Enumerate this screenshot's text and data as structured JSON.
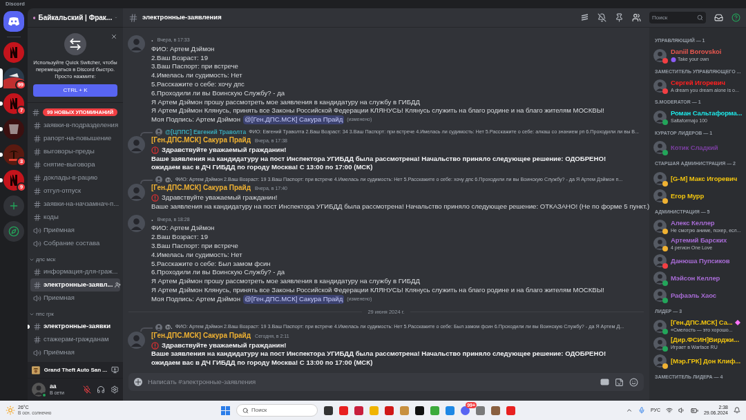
{
  "app": {
    "title": "Discord"
  },
  "servers": [
    {
      "kind": "home",
      "selected": false,
      "unread": false
    },
    {
      "kind": "red",
      "selected": false,
      "unread": false
    },
    {
      "kind": "photo",
      "selected": true,
      "unread": false,
      "badge": "99"
    },
    {
      "kind": "red",
      "selected": false,
      "unread": true,
      "badge": "7"
    },
    {
      "kind": "dark",
      "selected": false,
      "unread": true
    },
    {
      "kind": "palm",
      "selected": false,
      "unread": true,
      "badge": "3"
    },
    {
      "kind": "red",
      "selected": false,
      "unread": true,
      "badge": "9"
    },
    {
      "kind": "add"
    },
    {
      "kind": "discover"
    }
  ],
  "server_header": {
    "name": "Байкальский | Фрак..."
  },
  "quick_switcher": {
    "text": "Используйте Quick Switcher, чтобы перемещаться в Discord быстро. Просто нажмите:",
    "button": "CTRL + K"
  },
  "channels": [
    {
      "kind": "mentions",
      "badge": "99 НОВЫХ УПОМИНАНИЙ"
    },
    {
      "kind": "text",
      "name": "заявки-в-подразделения",
      "selected": false,
      "unread": false
    },
    {
      "kind": "text",
      "name": "рапорт-на-повышение",
      "selected": false,
      "unread": false
    },
    {
      "kind": "text",
      "name": "выговоры-преды",
      "selected": false,
      "unread": false
    },
    {
      "kind": "text",
      "name": "снятие-выговора",
      "selected": false,
      "unread": false
    },
    {
      "kind": "text",
      "name": "доклады-в-рацию",
      "selected": false,
      "unread": false
    },
    {
      "kind": "text",
      "name": "отгул-отпуск",
      "selected": false,
      "unread": false
    },
    {
      "kind": "text",
      "name": "заявки-на-начзамнач-п...",
      "selected": false,
      "unread": false
    },
    {
      "kind": "text",
      "name": "коды",
      "selected": false,
      "unread": false
    },
    {
      "kind": "voice",
      "name": "Приёмная",
      "selected": false,
      "unread": false
    },
    {
      "kind": "voice",
      "name": "Собрание состава",
      "selected": false,
      "unread": false
    },
    {
      "kind": "category",
      "name": "дпс мск",
      "expanded": true
    },
    {
      "kind": "text",
      "name": "информация-для-граж...",
      "selected": false,
      "unread": false
    },
    {
      "kind": "text",
      "name": "электронные-заявл...",
      "selected": true,
      "unread": false
    },
    {
      "kind": "voice",
      "name": "Приемная",
      "selected": false,
      "unread": false
    },
    {
      "kind": "category",
      "name": "ппс грк",
      "expanded": true
    },
    {
      "kind": "text",
      "name": "электронные-заявки",
      "selected": false,
      "unread": true
    },
    {
      "kind": "text",
      "name": "стажерам-гражданам",
      "selected": false,
      "unread": false
    },
    {
      "kind": "voice",
      "name": "Приёмная",
      "selected": false,
      "unread": false
    }
  ],
  "activity": {
    "name": "Grand Theft Auto San ..."
  },
  "user": {
    "name": "aa",
    "status": "В сети",
    "mic_muted": true
  },
  "header": {
    "channel": "электронные-заявления",
    "search_placeholder": "Поиск"
  },
  "messages": [
    {
      "author": {
        "name": "."
      },
      "time": "Вчера, в 17:33",
      "lines": [
        {
          "text": "ФИО: Артем Дэймон",
          "bold": false,
          "alert": false
        },
        {
          "text": "2.Ваш Возраст: 19",
          "bold": false,
          "alert": false
        },
        {
          "text": "3.Ваш Паспорт: при встрече",
          "bold": false,
          "alert": false
        },
        {
          "text": "4.Имелась ли судимость: Нет",
          "bold": false,
          "alert": false
        },
        {
          "text": "5.Расскажите о себе:  хочу дпс",
          "bold": false,
          "alert": false
        },
        {
          "text": "6.Проходили ли вы Воинскую Службу? -  да",
          "bold": false,
          "alert": false
        },
        {
          "text": "Я  Артем Дэймон прошу рассмотреть мое заявления в кандидатуру на службу в ГИБДД",
          "bold": false,
          "alert": false
        },
        {
          "text": "Я  Артем Дэймон Клянусь, принять все Законы Российской Федерации КЛЯНУСЬ! Клянусь служить на благо родине и на благо жителям МОСКВЫ!",
          "bold": false,
          "alert": false
        },
        {
          "text": "Моя Подпись: Артем Дэймон",
          "bold": false,
          "alert": false,
          "mention": "@[Ген.ДПС.МСК] Сакура Прайд",
          "edited": "(изменено)"
        }
      ]
    },
    {
      "reply": {
        "author": {
          "name": "@[ЦППС] Евгений Траволта",
          "color": "#3aa6b5"
        },
        "text": "ФИО: Евгений Траволта 2.Ваш Возраст: 34 3.Ваш Паспорт: при встрече 4.Имелась ли судимость: Нет 5.Расскажите о себе: алкаш со знанием рп 6.Проходили ли вы В..."
      },
      "author": {
        "name": "[Ген.ДПС.МСК] Сакура Прайд",
        "color": "#f0b232"
      },
      "time": "Вчера, в 17:38",
      "lines": [
        {
          "text": "Здравствуйте уважаемый гражданин!",
          "bold": true,
          "alert": true
        },
        {
          "text": "Ваше заявления на кандидатуру на пост Инспектора УГИБДД была рассмотрена! Начальство приняло следующее решение: ОДОБРЕНО!",
          "bold": true,
          "alert": false
        },
        {
          "text": "ожидаем вас в ДЧ ГИБДД по городу Москва! С 13:00 по 17:00 (МСК)",
          "bold": true,
          "alert": false
        }
      ]
    },
    {
      "reply": {
        "author": {
          "name": "@."
        },
        "text": "ФИО: Артем Дэймон 2.Ваш Возраст: 19 3.Ваш Паспорт: при встрече 4.Имелась ли судимость: Нет 5.Расскажите о себе:  хочу дпс 6.Проходили ли вы Воинскую Службу? -  да Я  Артем Дэймон п..."
      },
      "author": {
        "name": "[Ген.ДПС.МСК] Сакура Прайд",
        "color": "#f0b232"
      },
      "time": "Вчера, в 17:40",
      "lines": [
        {
          "text": "Здравствуйте уважаемый гражданин!",
          "bold": false,
          "alert": true
        },
        {
          "text": "Ваше заявления на кандидатуру на пост Инспектора УГИБДД была рассмотрена! Начальство приняло следующее решение: ОТКАЗАНО! (Не по форме 5 пункт.)",
          "bold": false,
          "alert": false
        }
      ]
    },
    {
      "author": {
        "name": "."
      },
      "time": "Вчера, в 18:28",
      "lines": [
        {
          "text": "ФИО: Артем Дэймон",
          "bold": false,
          "alert": false
        },
        {
          "text": "2.Ваш Возраст: 19",
          "bold": false,
          "alert": false
        },
        {
          "text": "3.Ваш Паспорт: при встрече",
          "bold": false,
          "alert": false
        },
        {
          "text": "4.Имелась ли судимость: Нет",
          "bold": false,
          "alert": false
        },
        {
          "text": "5.Расскажите о себе:  Был замом фсин",
          "bold": false,
          "alert": false
        },
        {
          "text": "6.Проходили ли вы Воинскую Службу? -  да",
          "bold": false,
          "alert": false
        },
        {
          "text": "Я  Артем Дэймон прошу рассмотреть мое заявления в кандидатуру на службу в ГИБДД",
          "bold": false,
          "alert": false
        },
        {
          "text": "Я  Артем Дэймон Клянусь, принять все Законы Российской Федерации КЛЯНУСЬ! Клянусь служить на благо родине и на благо жителям МОСКВЫ!",
          "bold": false,
          "alert": false
        },
        {
          "text": "Моя Подпись: Артем Дэймон",
          "bold": false,
          "alert": false,
          "mention": "@[Ген.ДПС.МСК] Сакура Прайд",
          "edited": "(изменено)"
        }
      ]
    },
    {
      "divider": "29 июня 2024 г.",
      "reply": {
        "author": {
          "name": "@."
        },
        "text": "ФИО: Артем Дэймон 2.Ваш Возраст: 19 3.Ваш Паспорт: при встрече 4.Имелась ли судимость: Нет 5.Расскажите о себе:  Был замом фсин 6.Проходили ли вы Воинскую Службу? -  да Я  Артем Д..."
      },
      "author": {
        "name": "[Ген.ДПС.МСК] Сакура Прайд",
        "color": "#f0b232"
      },
      "time": "Сегодня, в 2:11",
      "lines": [
        {
          "text": "Здравствуйте уважаемый гражданин!",
          "bold": true,
          "alert": true
        },
        {
          "text": "Ваше заявления на кандидатуру на пост Инспектора УГИБДД была рассмотрена! Начальство приняло следующее решение: ОДОБРЕНО!",
          "bold": true,
          "alert": false
        },
        {
          "text": "ожидаем вас в ДЧ ГИБДД по городу Москва! С 13:00 по 17:00 (МСК)",
          "bold": true,
          "alert": false
        }
      ]
    }
  ],
  "composer": {
    "placeholder": "Написать #электронные-заявления"
  },
  "member_groups": [
    {
      "title": "УПРАВЛЯЮЩИЙ — 1",
      "members": [
        {
          "name": "Daniil Borovskoi",
          "color": "#e8574f",
          "status": {
            "color": "#f23f43"
          },
          "subtitle": "Take your own",
          "emoji": true
        }
      ]
    },
    {
      "title": "ЗАМЕСТИТЕЛЬ УПРАВЛЯЮЩЕГО ...",
      "members": [
        {
          "name": "Сергей Игоревич",
          "color": "#ff2020",
          "status": {
            "color": "#f23f43"
          },
          "subtitle": "A dream you dream alone is o..."
        }
      ]
    },
    {
      "title": "S.MODERATOR — 1",
      "members": [
        {
          "name": "Роман Сальтаформа...",
          "color": "#1ee8e8",
          "status": {
            "color": "#23a55a"
          },
          "subtitle": "Saltaformajo 100"
        }
      ]
    },
    {
      "title": "КУРАТОР ЛИДЕРОВ — 1",
      "members": [
        {
          "name": "Котик Сладкий",
          "color": "#7b3fa0",
          "status": {
            "color": "#23a55a"
          }
        }
      ]
    },
    {
      "title": "СТАРШАЯ АДМИНИСТРАЦИЯ — 2",
      "members": [
        {
          "name": "[G-M] Макс Игоревич",
          "color": "#f1c40f",
          "status": {
            "color": "#f0b232"
          }
        },
        {
          "name": "Егор Мурр",
          "color": "#f1c40f",
          "status": {
            "color": "#f0b232"
          }
        }
      ]
    },
    {
      "title": "АДМИНИСТРАЦИЯ — 5",
      "members": [
        {
          "name": "Алекс Келлер",
          "color": "#a66bd3",
          "status": {
            "color": "#f0b232"
          },
          "subtitle": "Не смотрю аниме, похер, есл..."
        },
        {
          "name": "Артемий Барских",
          "color": "#a66bd3",
          "status": {
            "color": "#f0b232"
          },
          "subtitle": "4 регион One Love"
        },
        {
          "name": "Данюша Пупсиков",
          "color": "#a66bd3",
          "status": {
            "color": "#f23f43"
          }
        },
        {
          "name": "Мэйсон Келлер",
          "color": "#a66bd3",
          "status": {
            "color": "#23a55a"
          }
        },
        {
          "name": "Рафаэль Хаос",
          "color": "#a66bd3",
          "status": {
            "color": "#23a55a"
          }
        }
      ]
    },
    {
      "title": "ЛИДЕР — 3",
      "members": [
        {
          "name": "[Ген.ДПС.МСК] Са...",
          "color": "#f1c40f",
          "status": {
            "color": "#23a55a"
          },
          "subtitle": "«Смелость — это хорошо...",
          "booster": true
        },
        {
          "name": "[Дир.ФСИН]Вирджи...",
          "color": "#f1c40f",
          "status": {
            "color": "#23a55a"
          },
          "subtitle": "Играет в Warface RU"
        },
        {
          "name": "[Мэр.ГРК] Дон Клиф...",
          "color": "#f1c40f",
          "status": {
            "color": "#f0b232"
          }
        }
      ]
    },
    {
      "title": "ЗАМЕСТИТЕЛЬ ЛИДЕРА — 4"
    }
  ],
  "taskbar": {
    "temperature": "26°C",
    "weather": "В осн. солнечно",
    "search_placeholder": "Поиск",
    "discord_badge": "99+",
    "language": "РУС",
    "time": "2:38",
    "date": "29.06.2024"
  }
}
